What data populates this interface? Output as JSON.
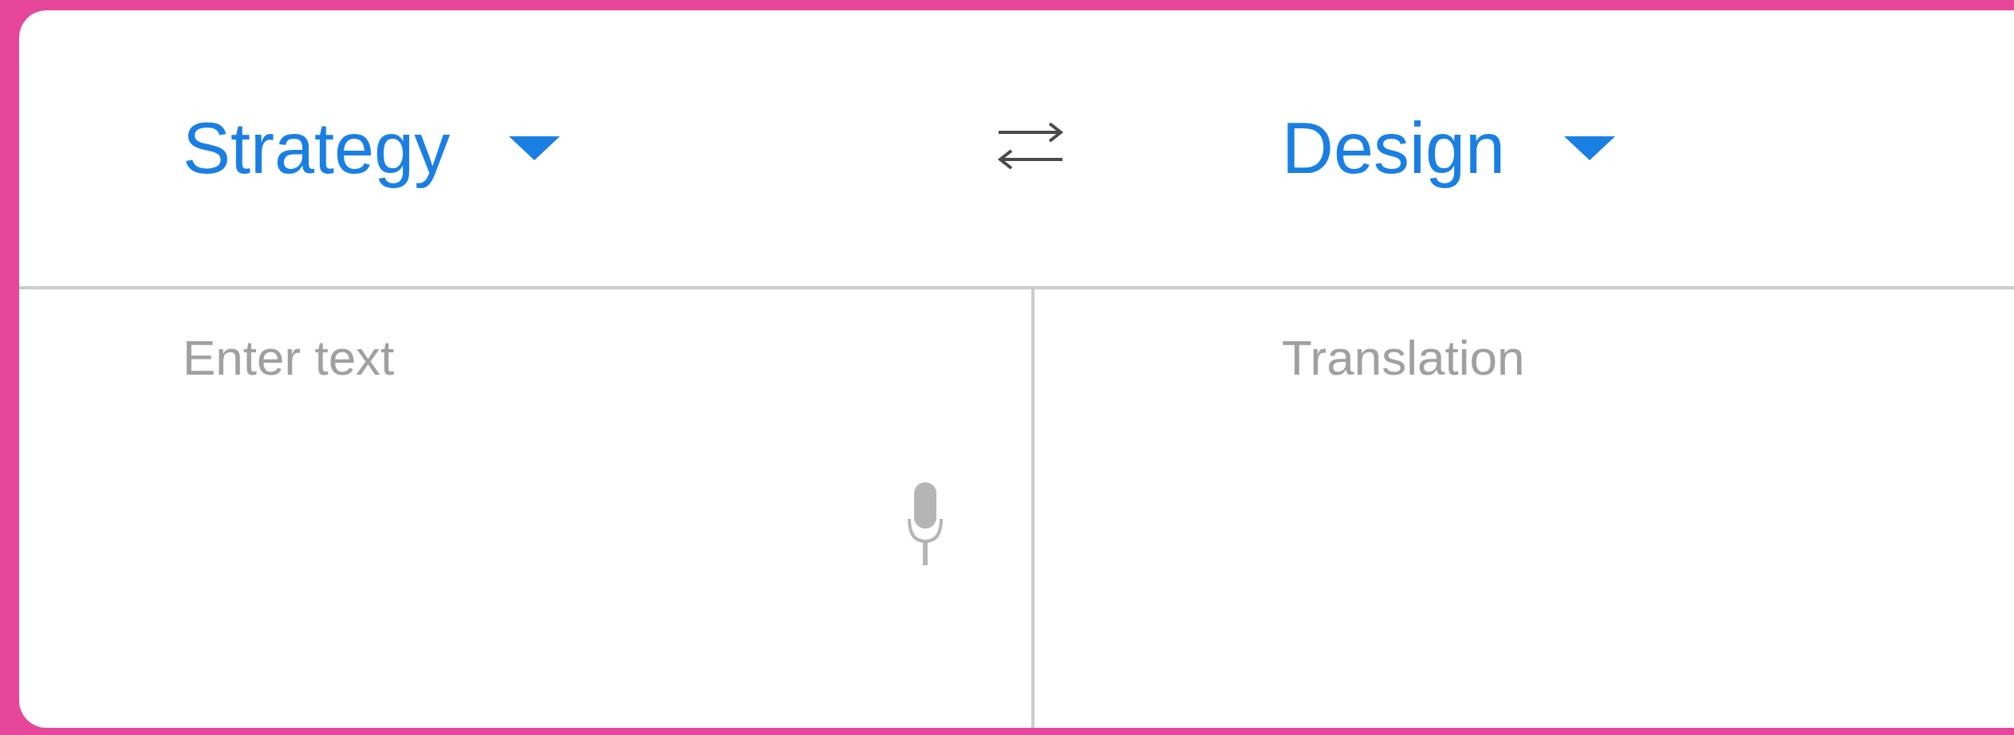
{
  "source_language": {
    "label": "Strategy"
  },
  "target_language": {
    "label": "Design"
  },
  "source_input": {
    "placeholder": "Enter text"
  },
  "translation_output": {
    "placeholder": "Translation"
  }
}
